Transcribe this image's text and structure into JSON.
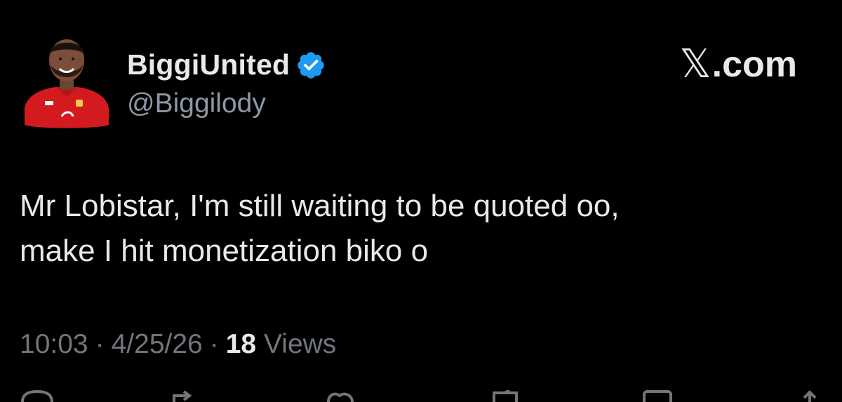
{
  "tweet": {
    "author": {
      "display_name": "BiggiUnited",
      "handle": "@Biggilody",
      "verified": true,
      "avatar_icon": "user-avatar-red-jersey",
      "verified_color": "#1d9bf0"
    },
    "brand": {
      "glyph": "𝕏",
      "domain": ".com"
    },
    "text_lines": [
      "Mr Lobistar, I'm still waiting to be quoted oo,",
      "make I hit monetization biko o"
    ],
    "meta": {
      "time": "10:03",
      "date": "4/25/26",
      "views_count": "18",
      "views_label": "Views",
      "separator": "·"
    },
    "actions": [
      {
        "icon": "reply-icon"
      },
      {
        "icon": "repost-icon"
      },
      {
        "icon": "like-icon"
      },
      {
        "icon": "bookmark-icon"
      },
      {
        "icon": "views-icon"
      },
      {
        "icon": "share-icon"
      }
    ]
  }
}
